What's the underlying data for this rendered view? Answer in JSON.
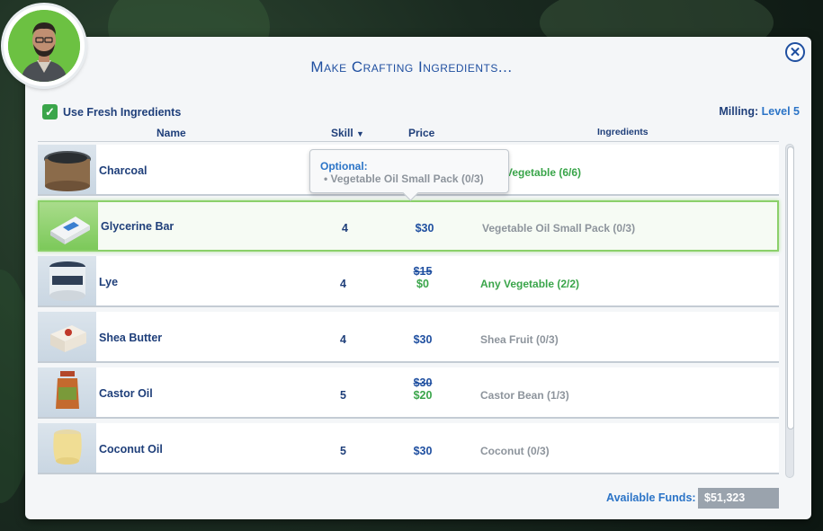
{
  "dialog": {
    "title": "Make Crafting Ingredients...",
    "close_glyph": "✕",
    "use_fresh_label": "Use Fresh Ingredients",
    "use_fresh_checked": true,
    "milling_label": "Milling:",
    "milling_value": "Level 5"
  },
  "columns": {
    "name": "Name",
    "skill": "Skill",
    "sort_glyph": "▼",
    "price": "Price",
    "ingredients": "Ingredients"
  },
  "rows": [
    {
      "name": "Charcoal",
      "skill": "",
      "price": "",
      "ingredients": "Vegetable (6/6)",
      "ingredients_ok": true,
      "icon": "charcoal-icon"
    },
    {
      "name": "Glycerine Bar",
      "skill": "4",
      "price": "$30",
      "ingredients": "Vegetable Oil Small Pack (0/3)",
      "ingredients_ok": false,
      "icon": "glycerine-bar-icon"
    },
    {
      "name": "Lye",
      "skill": "4",
      "price_old": "$15",
      "price_new": "$0",
      "ingredients": "Any Vegetable (2/2)",
      "ingredients_ok": true,
      "icon": "lye-jar-icon"
    },
    {
      "name": "Shea Butter",
      "skill": "4",
      "price": "$30",
      "ingredients": "Shea Fruit (0/3)",
      "ingredients_ok": false,
      "icon": "shea-butter-box-icon"
    },
    {
      "name": "Castor Oil",
      "skill": "5",
      "price_old": "$30",
      "price_new": "$20",
      "ingredients": "Castor Bean (1/3)",
      "ingredients_ok": false,
      "icon": "castor-oil-bottle-icon"
    },
    {
      "name": "Coconut Oil",
      "skill": "5",
      "price": "$30",
      "ingredients": "Coconut (0/3)",
      "ingredients_ok": false,
      "icon": "coconut-oil-jar-icon"
    }
  ],
  "tooltip": {
    "title": "Optional:",
    "item": "• Vegetable Oil Small Pack (0/3)"
  },
  "funds": {
    "label": "Available Funds:",
    "value": "$51,323"
  },
  "colors": {
    "accent": "#1f4fa0",
    "ok_green": "#3aa54a",
    "missing_gray": "#8d949c",
    "selected_border": "#8bd06a"
  }
}
